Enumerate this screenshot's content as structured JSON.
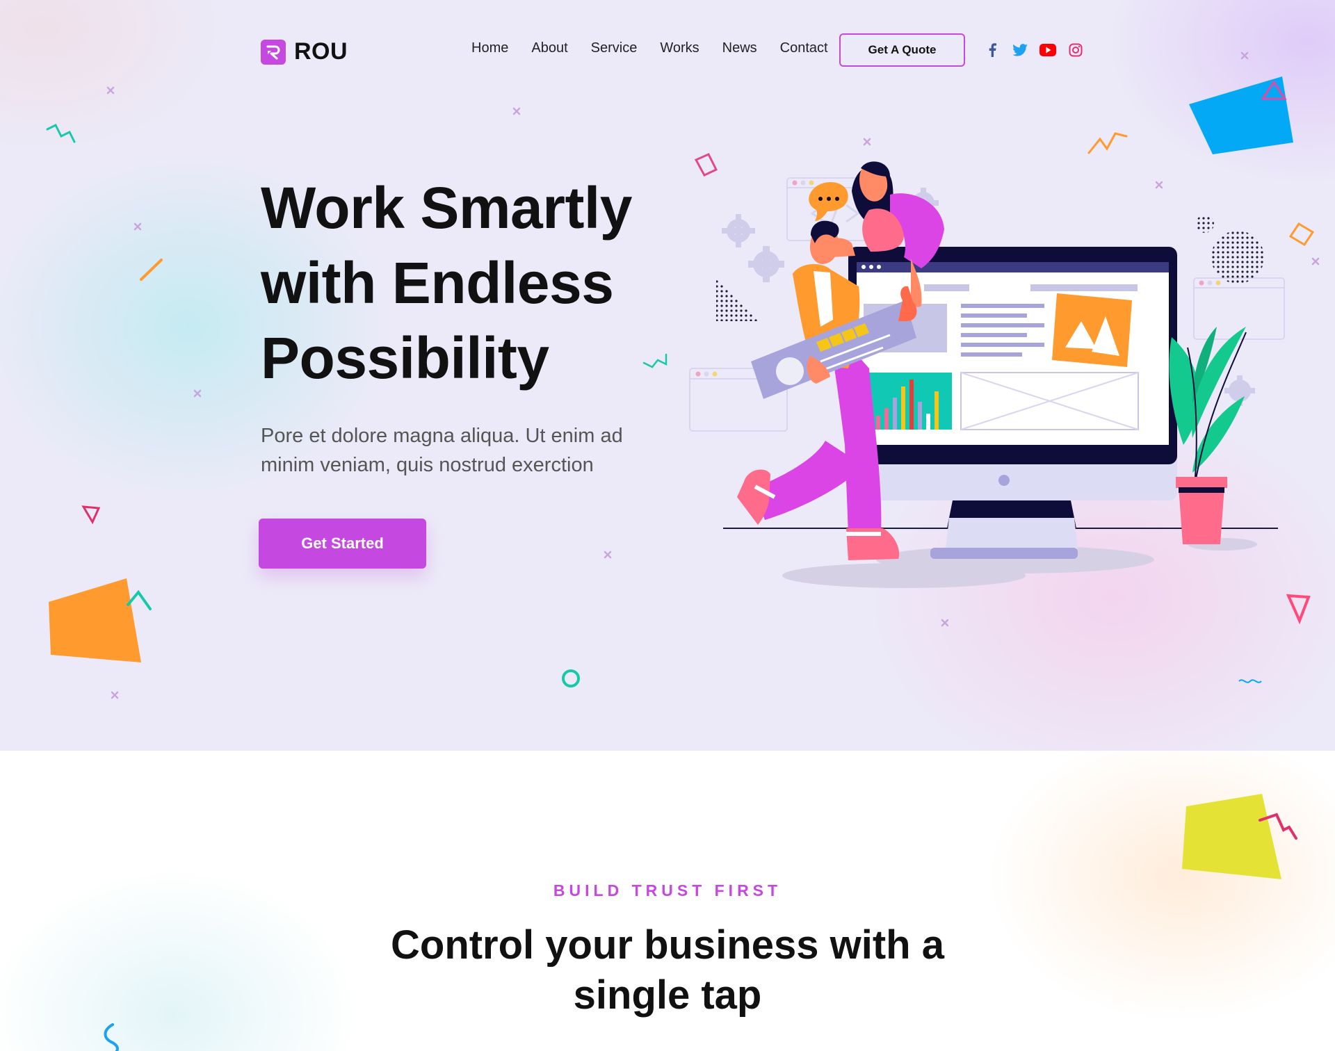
{
  "brand": {
    "name": "ROU",
    "accent": "#c549e0"
  },
  "nav": {
    "items": [
      {
        "label": "Home"
      },
      {
        "label": "About"
      },
      {
        "label": "Service"
      },
      {
        "label": "Works"
      },
      {
        "label": "News"
      },
      {
        "label": "Contact"
      }
    ],
    "cta_label": "Get A Quote"
  },
  "socials": [
    {
      "icon": "facebook-icon",
      "color": "#3b5998"
    },
    {
      "icon": "twitter-icon",
      "color": "#1da1f2"
    },
    {
      "icon": "youtube-icon",
      "color": "#ff0000"
    },
    {
      "icon": "instagram-icon",
      "color": "#e1306c"
    }
  ],
  "hero": {
    "title_lines": [
      "Work Smartly",
      "with Endless",
      "Possibility"
    ],
    "subtitle": "Pore et dolore magna aliqua. Ut enim ad minim veniam, quis nostrud exerction",
    "button_label": "Get Started"
  },
  "section": {
    "eyebrow": "BUILD TRUST FIRST",
    "title": "Control your business with a single tap"
  }
}
